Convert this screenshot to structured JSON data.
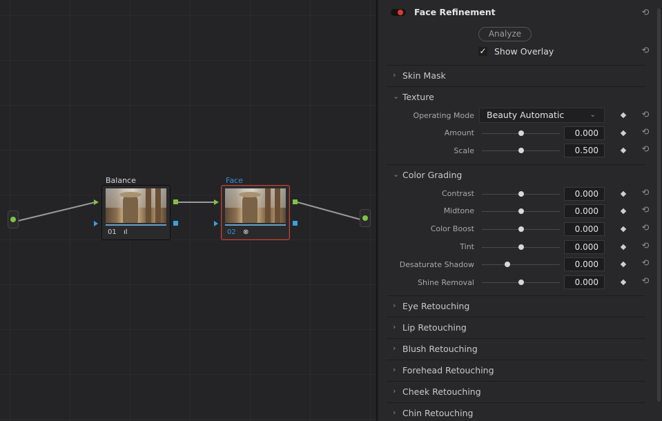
{
  "node_editor": {
    "nodes": [
      {
        "label": "Balance",
        "number": "01",
        "badge": "ıl"
      },
      {
        "label": "Face",
        "number": "02",
        "badge": "⊗"
      }
    ]
  },
  "panel": {
    "title": "Face Refinement",
    "analyze_label": "Analyze",
    "show_overlay_label": "Show Overlay",
    "show_overlay_checked": "✓",
    "sections": {
      "skin_mask": "Skin Mask",
      "texture": "Texture",
      "color_grading": "Color Grading",
      "eye": "Eye Retouching",
      "lip": "Lip Retouching",
      "blush": "Blush Retouching",
      "forehead": "Forehead Retouching",
      "cheek": "Cheek Retouching",
      "chin": "Chin Retouching"
    },
    "texture": {
      "operating_mode_label": "Operating Mode",
      "operating_mode_value": "Beauty Automatic",
      "amount_label": "Amount",
      "amount_value": "0.000",
      "scale_label": "Scale",
      "scale_value": "0.500"
    },
    "color_grading": {
      "contrast_label": "Contrast",
      "contrast_value": "0.000",
      "midtone_label": "Midtone",
      "midtone_value": "0.000",
      "color_boost_label": "Color Boost",
      "color_boost_value": "0.000",
      "tint_label": "Tint",
      "tint_value": "0.000",
      "desaturate_shadow_label": "Desaturate Shadow",
      "desaturate_shadow_value": "0.000",
      "shine_removal_label": "Shine Removal",
      "shine_removal_value": "0.000"
    }
  },
  "colors": {
    "accent_red": "#e2392f",
    "node_selected_border": "#b04a3c",
    "connector_green": "#7fc241",
    "connector_blue": "#3aa0e0"
  },
  "icons": {
    "reset": "reset-icon",
    "keyframe": "diamond-icon",
    "chevron_right": "chevron-right-icon",
    "chevron_down": "chevron-down-icon"
  }
}
